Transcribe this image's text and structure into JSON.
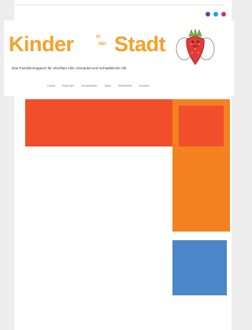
{
  "header": {
    "logo_part1": "Kinder",
    "logo_mid_1": "in",
    "logo_mid_2": "der",
    "logo_part2": "Stadt",
    "tagline": "Das Familienmagazin für Ulm/Neu-Ulm, Donautal und Schwäbische Alb",
    "mascot_icon": "strawberry-angel-mascot"
  },
  "social": {
    "icons": [
      "facebook-icon",
      "twitter-icon",
      "instagram-icon"
    ],
    "colors": [
      "#3b5998",
      "#1da1f2",
      "#c13584"
    ]
  },
  "nav": {
    "items": [
      "Home",
      "Kalender",
      "Veranstalter",
      "Spiel",
      "Mediathek",
      "Kontakt"
    ]
  },
  "colors": {
    "red": "#f14f2c",
    "orange": "#f58220",
    "blue": "#4a86c8",
    "logo": "#f5a12a"
  }
}
